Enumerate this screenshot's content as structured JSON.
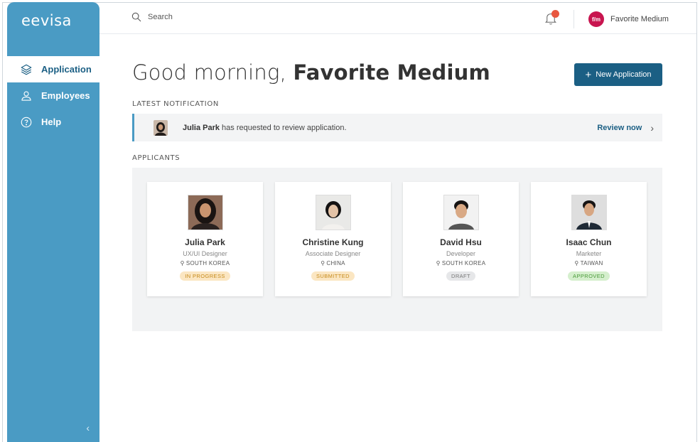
{
  "app": {
    "brand": "eevisa"
  },
  "sidebar": {
    "items": [
      {
        "label": "Application",
        "icon": "layers-icon",
        "active": true
      },
      {
        "label": "Employees",
        "icon": "users-icon",
        "active": false
      },
      {
        "label": "Help",
        "icon": "help-icon",
        "active": false
      }
    ],
    "collapse_glyph": "‹"
  },
  "topbar": {
    "search_placeholder": "Search",
    "notifications_count": "",
    "user": {
      "avatar_text": "f/m",
      "name": "Favorite Medium"
    }
  },
  "main": {
    "greeting_prefix": "Good morning, ",
    "greeting_name": "Favorite Medium",
    "new_application_label": "New Application",
    "latest_notification_heading": "LATEST NOTIFICATION",
    "notification": {
      "actor": "Julia Park",
      "message": " has requested to review application.",
      "action_label": "Review now"
    },
    "applicants_heading": "APPLICANTS",
    "applicants": [
      {
        "name": "Julia Park",
        "role": "UX/UI Designer",
        "location": "SOUTH KOREA",
        "status": "IN PROGRESS",
        "status_key": "progress"
      },
      {
        "name": "Christine Kung",
        "role": "Associate Designer",
        "location": "CHINA",
        "status": "SUBMITTED",
        "status_key": "submitted"
      },
      {
        "name": "David Hsu",
        "role": "Developer",
        "location": "SOUTH KOREA",
        "status": "DRAFT",
        "status_key": "draft"
      },
      {
        "name": "Isaac Chun",
        "role": "Marketer",
        "location": "TAIWAN",
        "status": "APPROVED",
        "status_key": "approved"
      }
    ]
  },
  "colors": {
    "sidebar": "#4a9bc4",
    "primary": "#1b5f84",
    "badge": "#e8573f",
    "avatar": "#c8154f"
  }
}
